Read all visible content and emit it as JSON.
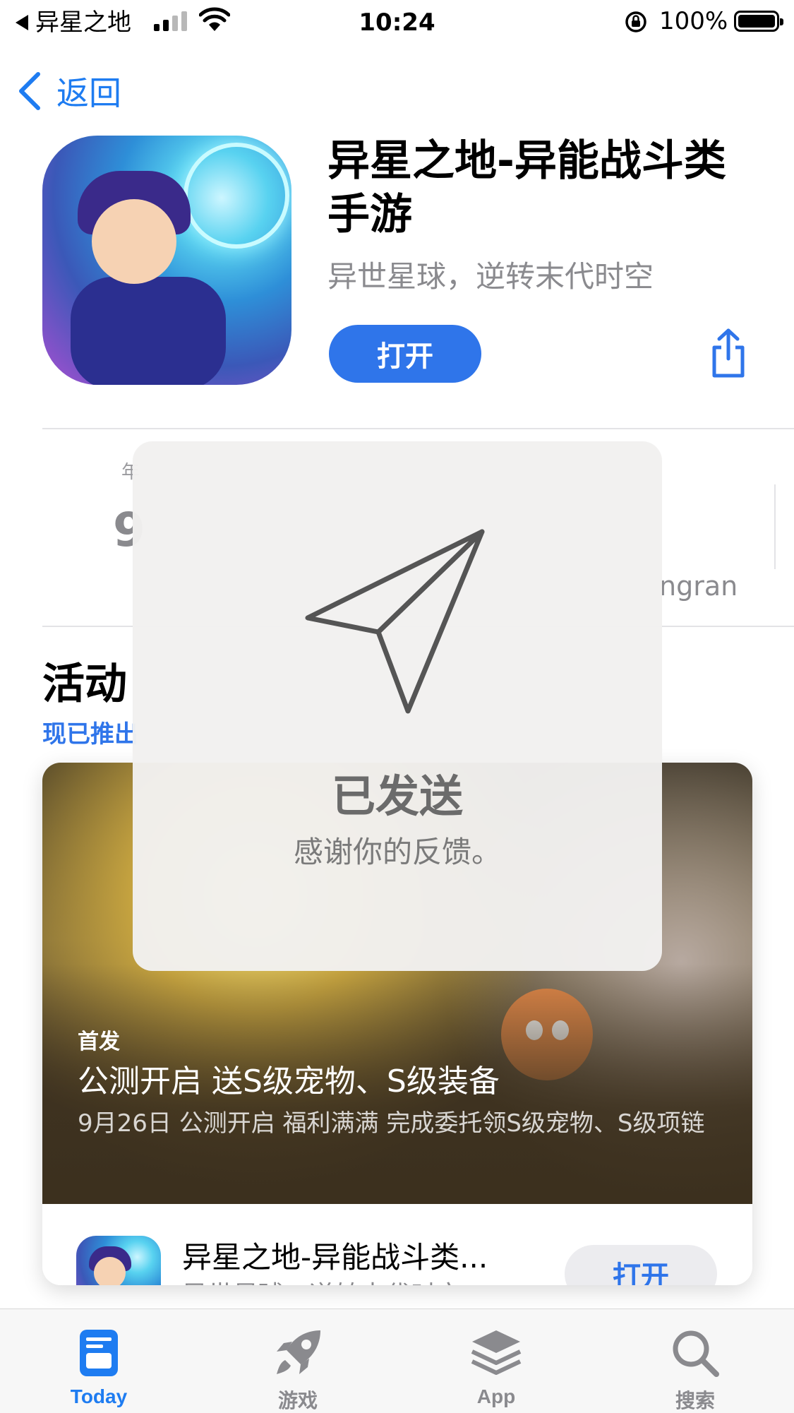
{
  "status_bar": {
    "back_app": "异星之地",
    "time": "10:24",
    "battery": "100%"
  },
  "nav": {
    "back_label": "返回"
  },
  "app": {
    "title": "异星之地-异能战斗类手游",
    "subtitle": "异世星球，逆转末代时空",
    "open_label": "打开"
  },
  "info_row": {
    "partial_label_left": "年",
    "partial_value_left": "9",
    "partial_developer": "ngran"
  },
  "events": {
    "section_title": "活动",
    "section_subtitle": "现已推出",
    "card": {
      "tag": "首发",
      "title": "公测开启 送S级宠物、S级装备",
      "description": "9月26日 公测开启 福利满满 完成委托领S级宠物、S级项链",
      "app_title": "异星之地-异能战斗类...",
      "app_subtitle": "异世星球，逆转末代时空",
      "open_label": "打开"
    }
  },
  "toast": {
    "icon": "paper-plane-icon",
    "title": "已发送",
    "message": "感谢你的反馈。"
  },
  "tab_bar": {
    "tabs": [
      {
        "label": "Today",
        "icon": "today-icon",
        "active": true
      },
      {
        "label": "游戏",
        "icon": "rocket-icon",
        "active": false
      },
      {
        "label": "App",
        "icon": "app-stack-icon",
        "active": false
      },
      {
        "label": "搜索",
        "icon": "search-icon",
        "active": false
      }
    ]
  },
  "colors": {
    "accent": "#2f75ea",
    "tab_active": "#1e7cf1",
    "tab_inactive": "#8a8a8e"
  }
}
